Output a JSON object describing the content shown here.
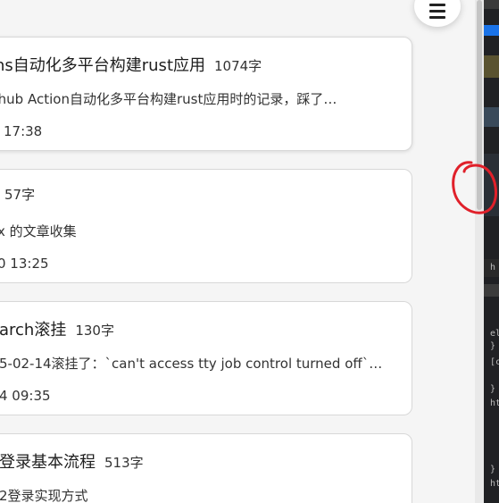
{
  "menu": {
    "icon": "hamburger-menu-icon"
  },
  "articles": [
    {
      "title": "ctions自动化多平台构建rust应用",
      "word_count": "1074字",
      "summary": "用Github Action自动化多平台构建rust应用时的记录，踩了…",
      "date": "17:38"
    },
    {
      "title": "",
      "word_count": "57字",
      "summary": "x 的文章收集",
      "date": "0 13:25"
    },
    {
      "title": "arch滚挂",
      "word_count": "130字",
      "summary": "5-02-14滚挂了：`can't access tty job control turned off`…",
      "date": "4 09:35"
    },
    {
      "title": "登录基本流程",
      "word_count": "513字",
      "summary": "2登录实现方式",
      "date": ""
    }
  ],
  "devtools": {
    "lines": [
      "h",
      "el",
      "}",
      "[c",
      "}",
      "ht",
      "}",
      "ht"
    ]
  },
  "colors": {
    "annotation": "#e0202a",
    "card_border": "#d8d8d8",
    "devtools_bg": "#202124"
  }
}
